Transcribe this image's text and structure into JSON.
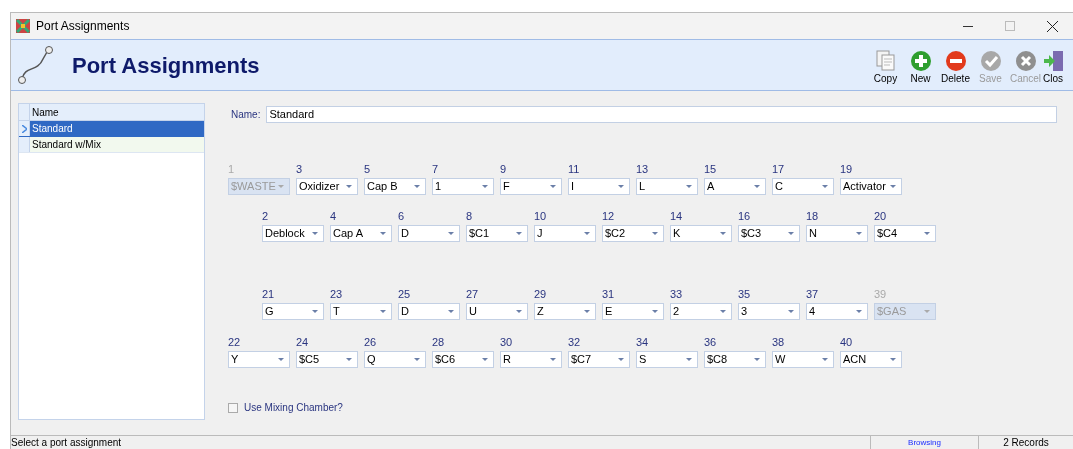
{
  "window": {
    "title": "Port Assignments"
  },
  "header": {
    "title": "Port Assignments"
  },
  "toolbar": [
    {
      "kind": "copy",
      "label": "Copy",
      "disabled": false
    },
    {
      "kind": "new",
      "label": "New",
      "disabled": false
    },
    {
      "kind": "delete",
      "label": "Delete",
      "disabled": false
    },
    {
      "kind": "save",
      "label": "Save",
      "disabled": true
    },
    {
      "kind": "cancel",
      "label": "Cancel",
      "disabled": true
    },
    {
      "kind": "close",
      "label": "Clos",
      "disabled": false
    }
  ],
  "list": {
    "column": "Name",
    "rows": [
      {
        "name": "Standard",
        "selected": true
      },
      {
        "name": "Standard w/Mix",
        "selected": false
      }
    ]
  },
  "form": {
    "name_label": "Name:",
    "name_value": "Standard",
    "port_rows": [
      [
        {
          "port": "1",
          "value": "$WASTE",
          "disabled": true
        },
        {
          "port": "3",
          "value": "Oxidizer",
          "disabled": false
        },
        {
          "port": "5",
          "value": "Cap B",
          "disabled": false
        },
        {
          "port": "7",
          "value": "1",
          "disabled": false
        },
        {
          "port": "9",
          "value": "F",
          "disabled": false
        },
        {
          "port": "11",
          "value": "I",
          "disabled": false
        },
        {
          "port": "13",
          "value": "L",
          "disabled": false
        },
        {
          "port": "15",
          "value": "A",
          "disabled": false
        },
        {
          "port": "17",
          "value": "C",
          "disabled": false
        },
        {
          "port": "19",
          "value": "Activator",
          "disabled": false
        }
      ],
      [
        {
          "port": "2",
          "value": "Deblock",
          "disabled": false
        },
        {
          "port": "4",
          "value": "Cap A",
          "disabled": false
        },
        {
          "port": "6",
          "value": "D",
          "disabled": false
        },
        {
          "port": "8",
          "value": "$C1",
          "disabled": false
        },
        {
          "port": "10",
          "value": "J",
          "disabled": false
        },
        {
          "port": "12",
          "value": "$C2",
          "disabled": false
        },
        {
          "port": "14",
          "value": "K",
          "disabled": false
        },
        {
          "port": "16",
          "value": "$C3",
          "disabled": false
        },
        {
          "port": "18",
          "value": "N",
          "disabled": false
        },
        {
          "port": "20",
          "value": "$C4",
          "disabled": false
        }
      ],
      [
        {
          "port": "21",
          "value": "G",
          "disabled": false
        },
        {
          "port": "23",
          "value": "T",
          "disabled": false
        },
        {
          "port": "25",
          "value": "D",
          "disabled": false
        },
        {
          "port": "27",
          "value": "U",
          "disabled": false
        },
        {
          "port": "29",
          "value": "Z",
          "disabled": false
        },
        {
          "port": "31",
          "value": "E",
          "disabled": false
        },
        {
          "port": "33",
          "value": "2",
          "disabled": false
        },
        {
          "port": "35",
          "value": "3",
          "disabled": false
        },
        {
          "port": "37",
          "value": "4",
          "disabled": false
        },
        {
          "port": "39",
          "value": "$GAS",
          "disabled": true
        }
      ],
      [
        {
          "port": "22",
          "value": "Y",
          "disabled": false
        },
        {
          "port": "24",
          "value": "$C5",
          "disabled": false
        },
        {
          "port": "26",
          "value": "Q",
          "disabled": false
        },
        {
          "port": "28",
          "value": "$C6",
          "disabled": false
        },
        {
          "port": "30",
          "value": "R",
          "disabled": false
        },
        {
          "port": "32",
          "value": "$C7",
          "disabled": false
        },
        {
          "port": "34",
          "value": "S",
          "disabled": false
        },
        {
          "port": "36",
          "value": "$C8",
          "disabled": false
        },
        {
          "port": "38",
          "value": "W",
          "disabled": false
        },
        {
          "port": "40",
          "value": "ACN",
          "disabled": false
        }
      ]
    ],
    "mixing": {
      "label": "Use Mixing Chamber?",
      "checked": false
    }
  },
  "status_bar": {
    "message": "Select a port assignment",
    "mode": "Browsing",
    "records": "2 Records"
  }
}
